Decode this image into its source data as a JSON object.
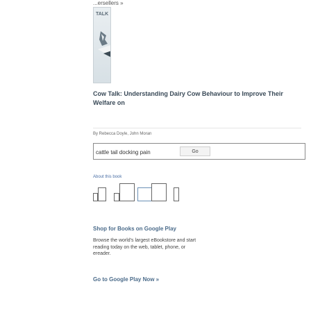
{
  "breadcrumb": "...ersellers »",
  "cover": {
    "label": "TALK"
  },
  "book": {
    "title": "Cow Talk: Understanding Dairy Cow Behaviour to Improve Their Welfare on",
    "authors": "By Rebecca Doyle, John Moran"
  },
  "search": {
    "value": "cattle tail docking pain",
    "button_label": "Go"
  },
  "about": {
    "label": "About this book"
  },
  "shop": {
    "title": "Shop for Books on Google Play",
    "text": "Browse the world's largest eBookstore and start reading today on the web, tablet, phone, or ereader.",
    "cta": "Go to Google Play Now »"
  },
  "colors": {
    "link": "#4b6b8a",
    "accent": "#4a6fa5"
  }
}
